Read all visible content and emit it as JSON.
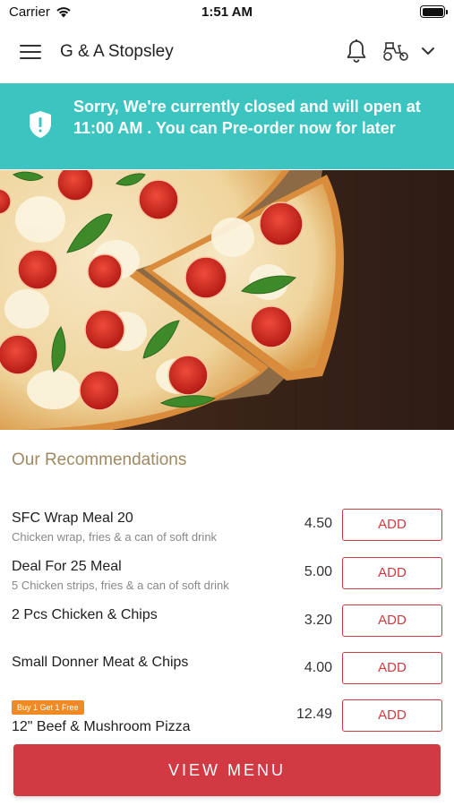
{
  "status_bar": {
    "carrier": "Carrier",
    "time": "1:51 AM"
  },
  "header": {
    "store_name": "G & A Stopsley",
    "icons": [
      "menu-icon",
      "bell-icon",
      "scooter-icon",
      "chevron-down-icon"
    ]
  },
  "banner": {
    "message": "Sorry, We're currently closed and will open at 11:00 AM . You can Pre-order now for later",
    "color": "#3cc5c0"
  },
  "recommendations": {
    "title": "Our Recommendations",
    "add_label": "ADD",
    "items": [
      {
        "name": "SFC Wrap Meal 20",
        "description": "Chicken wrap, fries & a can of soft drink",
        "price": "4.50"
      },
      {
        "name": "Deal For 25 Meal",
        "description": "5 Chicken strips, fries & a can of soft drink",
        "price": "5.00"
      },
      {
        "name": "2 Pcs Chicken & Chips",
        "description": "",
        "price": "3.20"
      },
      {
        "name": "Small Donner Meat & Chips",
        "description": "",
        "price": "4.00"
      },
      {
        "name": "12\" Beef & Mushroom Pizza",
        "description": "",
        "price": "12.49",
        "badge": "Buy 1 Get 1 Free"
      }
    ]
  },
  "view_menu_label": "VIEW MENU",
  "colors": {
    "accent": "#d13a42",
    "banner": "#3cc5c0",
    "section_title": "#a08963",
    "badge": "#f08a24"
  }
}
